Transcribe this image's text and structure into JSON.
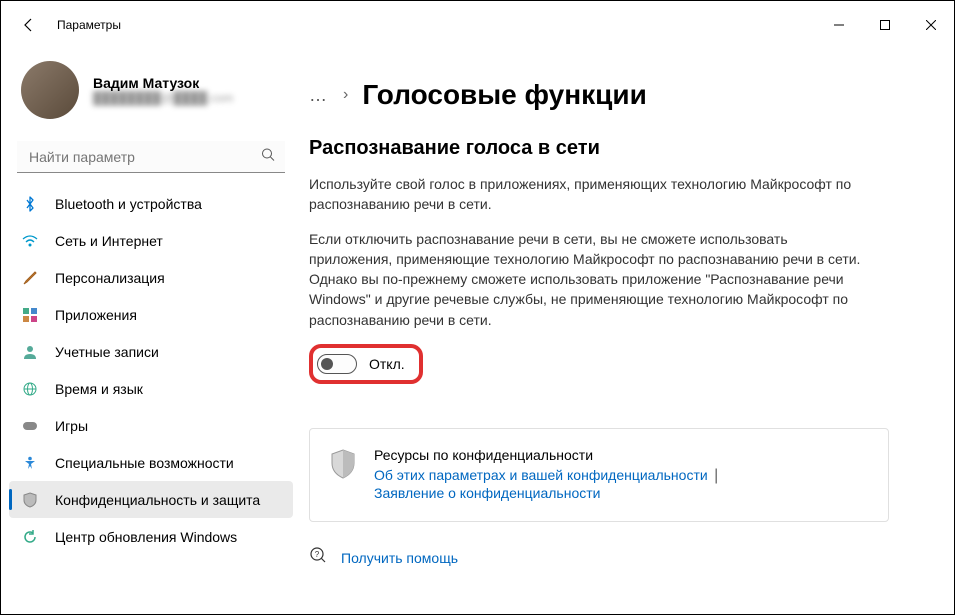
{
  "window": {
    "title": "Параметры"
  },
  "profile": {
    "name": "Вадим Матузок",
    "email": "████████@████.com"
  },
  "search": {
    "placeholder": "Найти параметр"
  },
  "sidebar": {
    "items": [
      {
        "label": "Bluetooth и устройства"
      },
      {
        "label": "Сеть и Интернет"
      },
      {
        "label": "Персонализация"
      },
      {
        "label": "Приложения"
      },
      {
        "label": "Учетные записи"
      },
      {
        "label": "Время и язык"
      },
      {
        "label": "Игры"
      },
      {
        "label": "Специальные возможности"
      },
      {
        "label": "Конфиденциальность и защита"
      },
      {
        "label": "Центр обновления Windows"
      }
    ]
  },
  "breadcrumb": {
    "more": "…",
    "title": "Голосовые функции"
  },
  "section": {
    "heading": "Распознавание голоса в сети",
    "p1": "Используйте свой голос в приложениях, применяющих технологию Майкрософт по распознаванию речи в сети.",
    "p2": "Если отключить распознавание речи в сети, вы не сможете использовать приложения, применяющие технологию Майкрософт по распознаванию речи в сети. Однако вы по-прежнему сможете использовать приложение \"Распознавание речи Windows\" и другие речевые службы, не применяющие технологию Майкрософт по распознаванию речи в сети.",
    "toggle_label": "Откл.",
    "toggle_state": "off"
  },
  "privacy_card": {
    "heading": "Ресурсы по конфиденциальности",
    "link1": "Об этих параметрах и вашей конфиденциальности",
    "link2": "Заявление о конфиденциальности"
  },
  "help": {
    "label": "Получить помощь"
  },
  "colors": {
    "accent": "#0067c0",
    "highlight_border": "#e03030"
  }
}
